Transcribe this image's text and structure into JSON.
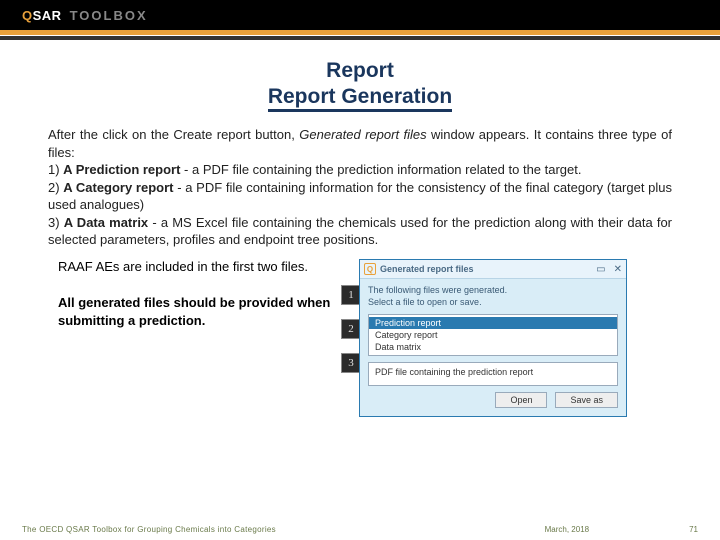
{
  "logo": {
    "q": "Q",
    "sar": "SAR",
    "toolbox": "TOOLBOX"
  },
  "title": "Report",
  "subtitle": "Report Generation",
  "intro": "After the click on the Create report button, ",
  "intro_ital": "Generated report files",
  "intro_tail": " window appears. It contains three type of files:",
  "items": {
    "i1_num": "1) ",
    "i1_bold": "A Prediction report",
    "i1_tail": " - a PDF file containing the prediction information related to the target.",
    "i2_num": "2) ",
    "i2_bold": "A Category report",
    "i2_tail": " - a PDF file containing information for the consistency of the final category (target plus used analogues)",
    "i3_num": "3) ",
    "i3_bold": "A Data matrix",
    "i3_tail": " - a MS Excel file containing the chemicals used for the prediction along with their data for selected parameters, profiles and endpoint tree positions."
  },
  "note1": "RAAF AEs are included in the first two files.",
  "note2": "All generated files should be provided when submitting a prediction.",
  "dialog": {
    "icon": "Q",
    "title": "Generated report files",
    "msg1": "The following files were generated.",
    "msg2": "Select a file to open or save.",
    "rows": {
      "r1": "Prediction report",
      "r2": "Category report",
      "r3": "Data matrix"
    },
    "desc": "PDF file containing the prediction report",
    "open": "Open",
    "saveas": "Save as"
  },
  "callouts": {
    "c1": "1",
    "c2": "2",
    "c3": "3"
  },
  "footer": {
    "left": "The OECD QSAR Toolbox for Grouping Chemicals into Categories",
    "mid": "March, 2018",
    "right": "71"
  }
}
